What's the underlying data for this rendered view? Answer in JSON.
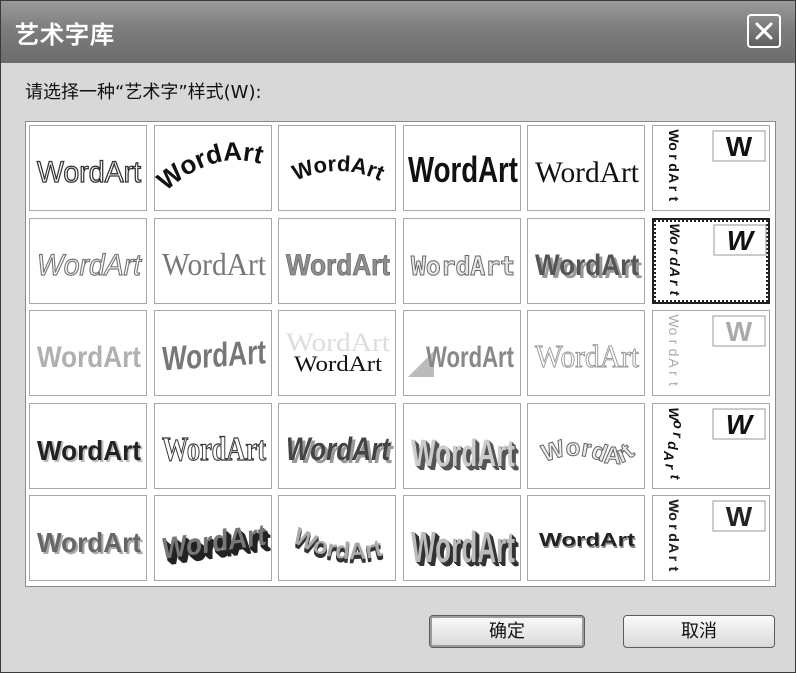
{
  "window": {
    "title": "艺术字库",
    "close_icon": "close-icon"
  },
  "prompt": "请选择一种“艺术字”样式(W):",
  "gallery": {
    "sample_text": "WordArt",
    "vertical_letters": [
      "W",
      "o",
      "r",
      "d",
      "A",
      "r",
      "t"
    ],
    "badge_text": "W",
    "selected_index": 11,
    "styles": [
      {
        "id": 1,
        "kind": "outline"
      },
      {
        "id": 2,
        "kind": "arched-bold"
      },
      {
        "id": 3,
        "kind": "arch-up"
      },
      {
        "id": 4,
        "kind": "condensed-bold"
      },
      {
        "id": 5,
        "kind": "serif"
      },
      {
        "id": 6,
        "kind": "vertical"
      },
      {
        "id": 7,
        "kind": "italic-outline"
      },
      {
        "id": 8,
        "kind": "thin-serif-gray"
      },
      {
        "id": 9,
        "kind": "gray-bold"
      },
      {
        "id": 10,
        "kind": "wide-outline"
      },
      {
        "id": 11,
        "kind": "shadow-bold"
      },
      {
        "id": 12,
        "kind": "vertical-italic"
      },
      {
        "id": 13,
        "kind": "gray-gradient"
      },
      {
        "id": 14,
        "kind": "slanted-bold"
      },
      {
        "id": 15,
        "kind": "echo-serif"
      },
      {
        "id": 16,
        "kind": "wedge"
      },
      {
        "id": 17,
        "kind": "light-serif"
      },
      {
        "id": 18,
        "kind": "vertical-light"
      },
      {
        "id": 19,
        "kind": "emboss"
      },
      {
        "id": 20,
        "kind": "condensed-outline"
      },
      {
        "id": 21,
        "kind": "italic-shadow"
      },
      {
        "id": 22,
        "kind": "3d-tall"
      },
      {
        "id": 23,
        "kind": "wave-outline"
      },
      {
        "id": 24,
        "kind": "vertical-wave"
      },
      {
        "id": 25,
        "kind": "stone"
      },
      {
        "id": 26,
        "kind": "3d-tilt"
      },
      {
        "id": 27,
        "kind": "3d-curve"
      },
      {
        "id": 28,
        "kind": "3d-block"
      },
      {
        "id": 29,
        "kind": "dotted-small"
      },
      {
        "id": 30,
        "kind": "vertical-3d"
      }
    ]
  },
  "buttons": {
    "ok": "确定",
    "cancel": "取消"
  },
  "colors": {
    "title_bg": "#7d7d7d",
    "dialog_bg": "#d8d8d8"
  }
}
